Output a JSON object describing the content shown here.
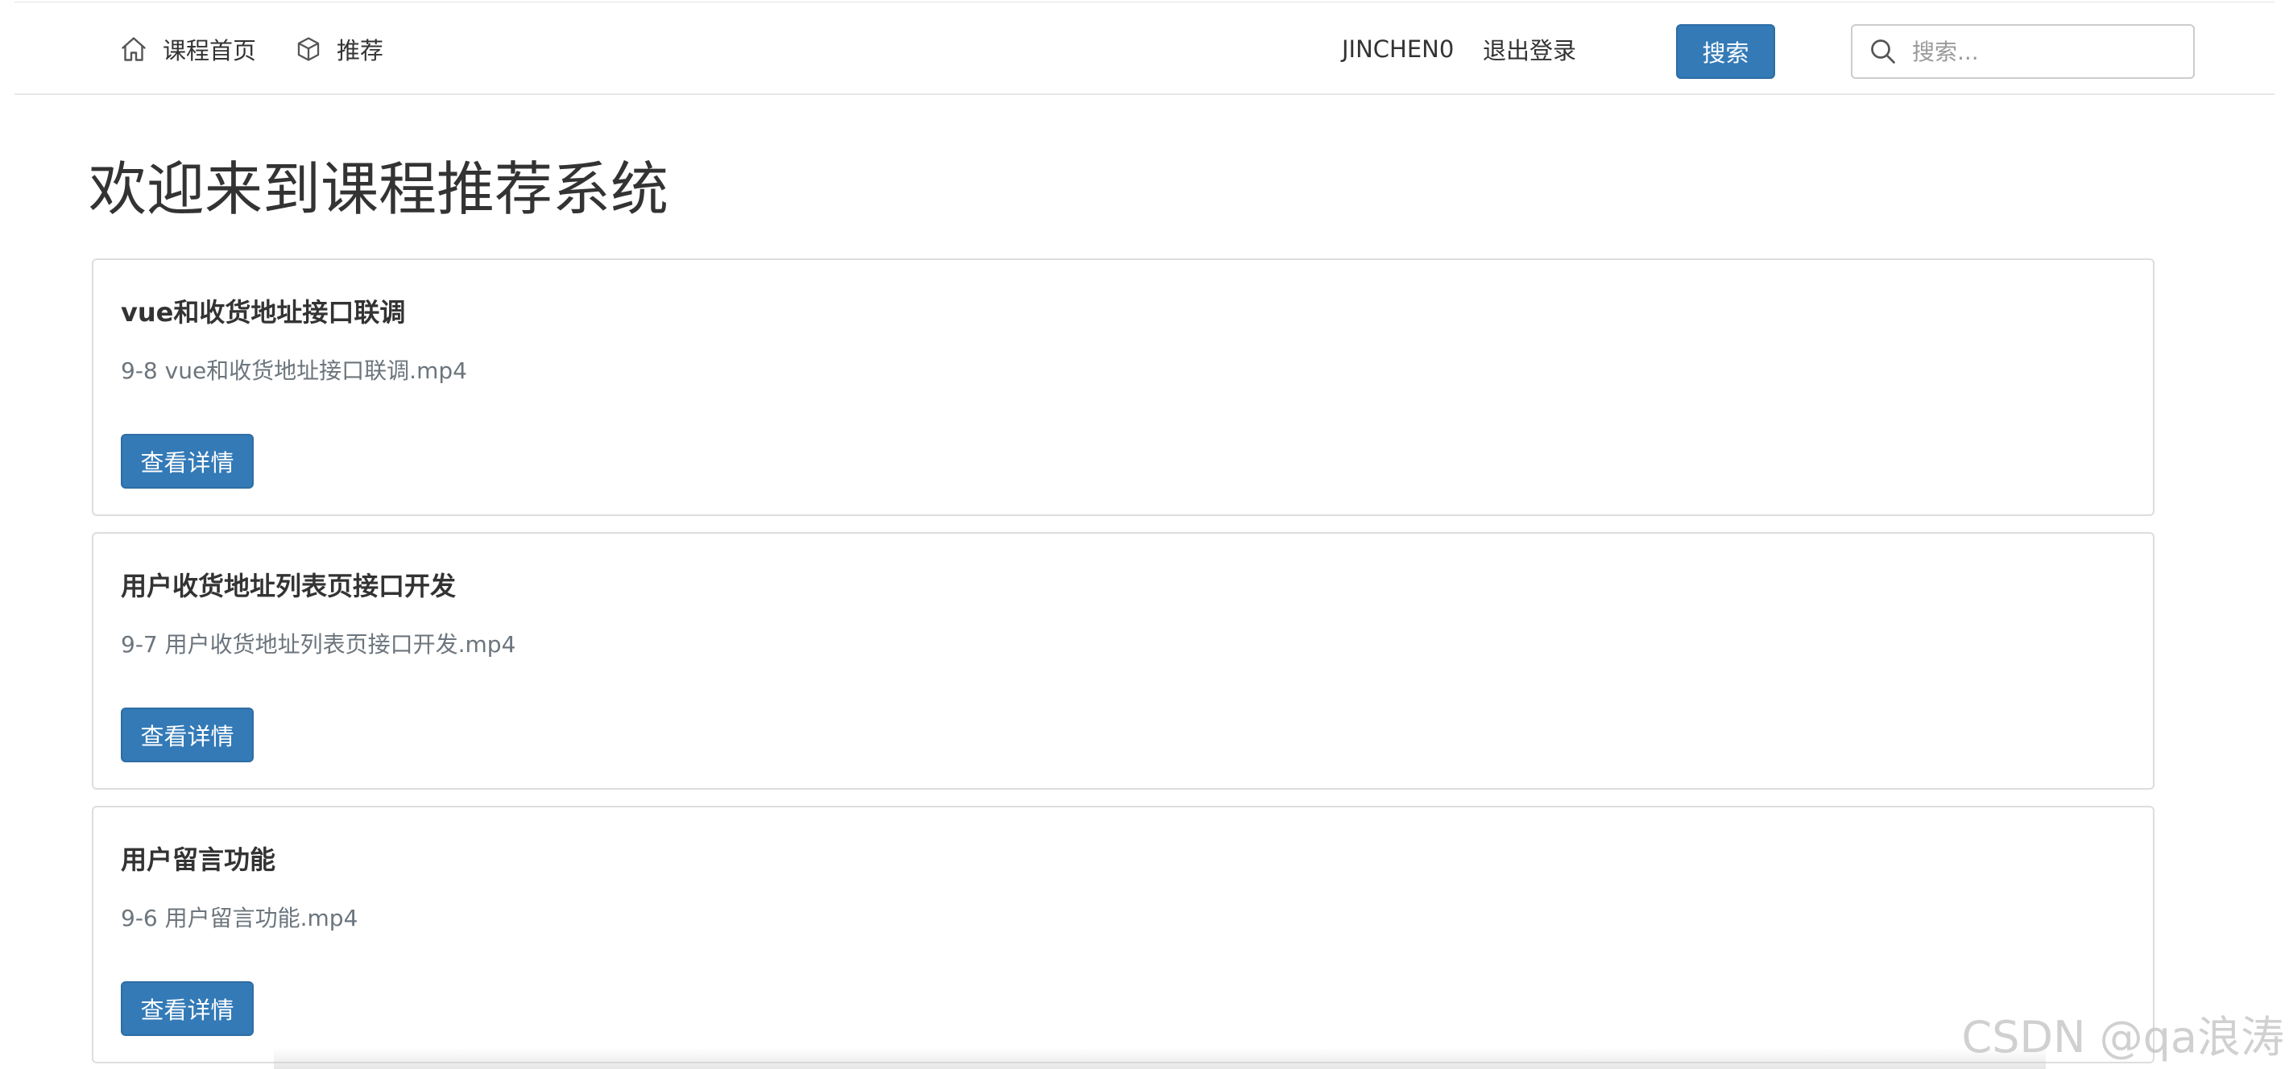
{
  "nav": {
    "home_label": "课程首页",
    "recommend_label": "推荐",
    "username": "JINCHEN0",
    "logout_label": "退出登录",
    "search_button_label": "搜索",
    "search_placeholder": "搜索...",
    "search_value": ""
  },
  "main": {
    "title": "欢迎来到课程推荐系统",
    "courses": [
      {
        "title": "vue和收货地址接口联调",
        "description": "9-8 vue和收货地址接口联调.mp4",
        "button_label": "查看详情"
      },
      {
        "title": "用户收货地址列表页接口开发",
        "description": "9-7 用户收货地址列表页接口开发.mp4",
        "button_label": "查看详情"
      },
      {
        "title": "用户留言功能",
        "description": "9-6 用户留言功能.mp4",
        "button_label": "查看详情"
      }
    ]
  },
  "watermark": "CSDN @qa浪涛",
  "icons": {
    "home": "home-icon",
    "recommend": "cube-icon",
    "search": "search-icon"
  },
  "colors": {
    "primary": "#337ab7",
    "primary_border": "#2e6da4",
    "text": "#333333",
    "muted_text": "#6c757d",
    "card_border": "#dddddd"
  }
}
